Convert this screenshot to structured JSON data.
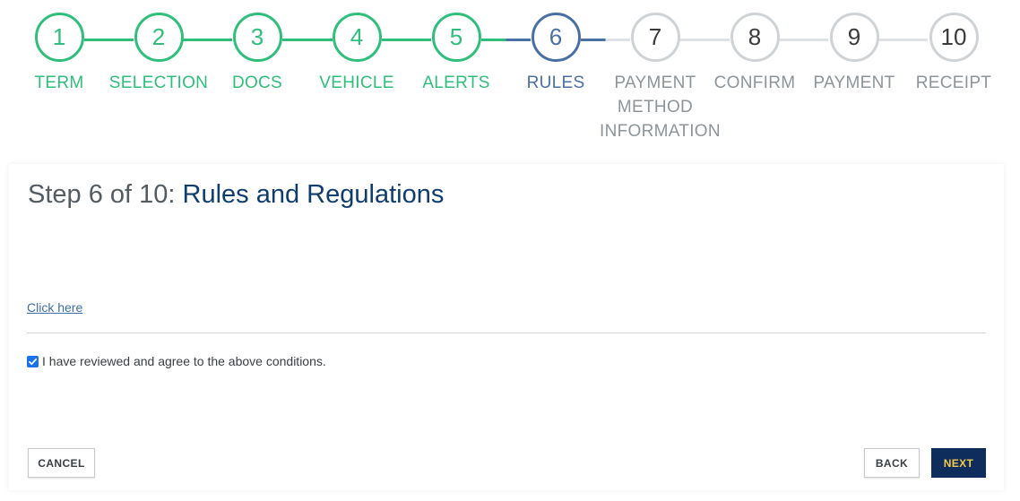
{
  "stepper": {
    "steps": [
      {
        "number": "1",
        "label": "TERM",
        "state": "done"
      },
      {
        "number": "2",
        "label": "SELECTION",
        "state": "done"
      },
      {
        "number": "3",
        "label": "DOCS",
        "state": "done"
      },
      {
        "number": "4",
        "label": "VEHICLE",
        "state": "done"
      },
      {
        "number": "5",
        "label": "ALERTS",
        "state": "done"
      },
      {
        "number": "6",
        "label": "RULES",
        "state": "current"
      },
      {
        "number": "7",
        "label": "PAYMENT METHOD INFORMATION",
        "state": "pending"
      },
      {
        "number": "8",
        "label": "CONFIRM",
        "state": "pending"
      },
      {
        "number": "9",
        "label": "PAYMENT",
        "state": "pending"
      },
      {
        "number": "10",
        "label": "RECEIPT",
        "state": "pending"
      }
    ]
  },
  "card": {
    "title_prefix": "Step 6 of 10:",
    "title_name": "Rules and Regulations",
    "link_text": "Click here",
    "agree_text": "I have reviewed and agree to the above conditions.",
    "agree_checked": true,
    "buttons": {
      "cancel": "CANCEL",
      "back": "BACK",
      "next": "NEXT"
    }
  },
  "colors": {
    "done": "#2fbf7a",
    "current": "#4a6fa5",
    "pending": "#cfd3d6",
    "title_name": "#0f3d6e",
    "next_bg": "#0f2d5c",
    "next_text": "#f2c94c",
    "checkbox": "#1a73e8"
  }
}
